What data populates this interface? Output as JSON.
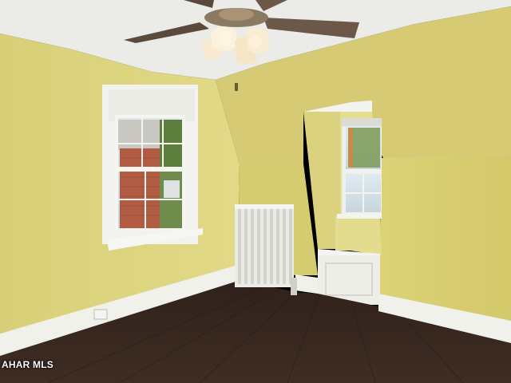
{
  "watermark": {
    "text": "AHAR MLS"
  },
  "colors": {
    "wall_left": "#ddd47e",
    "wall_right": "#d9cf72",
    "ceiling": "#ececea",
    "slope": "#cfc472",
    "trim": "#f1f1ec",
    "floor": "#3a2a22",
    "sky": "#d8e6ee",
    "brick": "#b55f45",
    "foliage": "#6c8a48"
  },
  "icons": {
    "fan": "ceiling-fan-icon",
    "radiator": "radiator-icon",
    "outlet": "electrical-outlet-icon"
  }
}
